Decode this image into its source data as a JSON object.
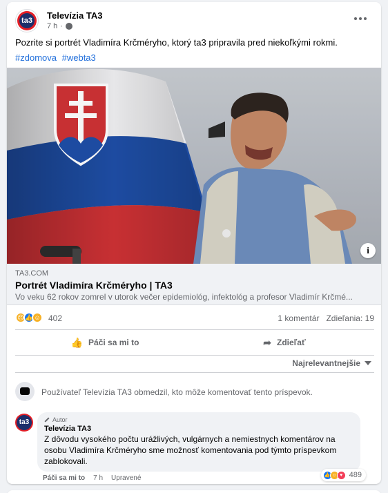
{
  "post": {
    "page_name": "Televízia TA3",
    "avatar_text": "ta3",
    "time": "7 h",
    "dot": "·",
    "text": "Pozrite si portrét Vladimíra Krčméryho, ktorý ta3 pripravila pred niekoľkými rokmi.",
    "hashtags": [
      "#zdomova",
      "#webta3"
    ]
  },
  "link": {
    "domain": "TA3.COM",
    "title": "Portrét Vladimíra Krčméryho | TA3",
    "description": "Vo veku 62 rokov zomrel v utorok večer epidemiológ, infektológ a profesor Vladimír Krčmé...",
    "info_icon": "i"
  },
  "stats": {
    "reactions_count": "402",
    "comments": "1 komentár",
    "shares": "Zdieľania: 19"
  },
  "actions": {
    "like": "Páči sa mi to",
    "share": "Zdieľať"
  },
  "sort": {
    "label": "Najrelevantnejšie"
  },
  "restriction": {
    "text": "Používateľ Televízia TA3 obmedzil, kto môže komentovať tento príspevok."
  },
  "comment": {
    "badge": "Autor",
    "author": "Televízia TA3",
    "text": "Z dôvodu vysokého počtu urážlivých, vulgárnych a nemiestnych komentárov na osobu Vladimíra Krčméryho sme možnosť komentovania pod týmto príspevkom zablokovali.",
    "like": "Páči sa mi to",
    "time": "7 h",
    "edited": "Upravené",
    "reactions_count": "489"
  },
  "colors": {
    "link_blue": "#216fdb",
    "secondary_text": "#65676b",
    "background": "#f0f2f5",
    "brand_red": "#e41e26",
    "brand_navy": "#1d2f6b"
  }
}
